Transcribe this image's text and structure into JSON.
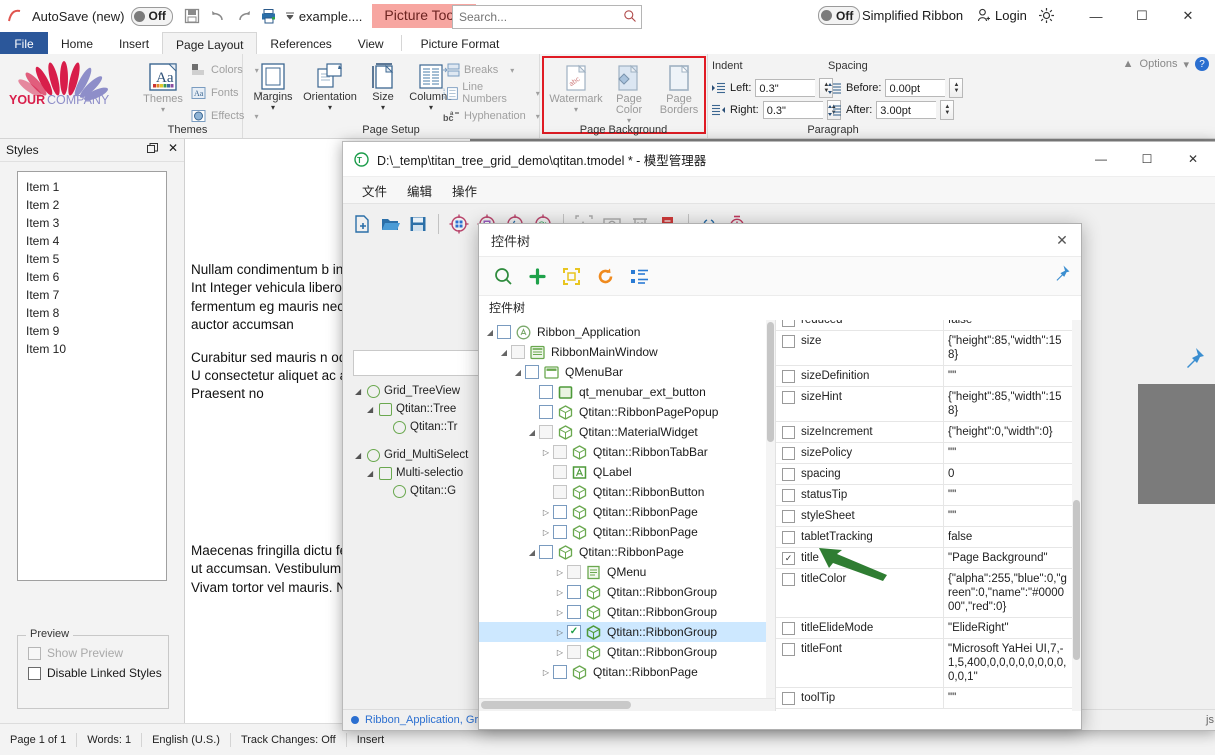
{
  "word": {
    "quick_access": {
      "autosave_label": "AutoSave (new)",
      "autosave_state": "Off",
      "save_icon": "save-icon",
      "undo_icon": "undo-icon",
      "redo_icon": "redo-icon",
      "print_icon": "print-icon",
      "dropdown_icon": "chevron-down-icon",
      "file_name": "example....",
      "contextual_tab": "Picture Tools"
    },
    "search": {
      "placeholder": "Search...",
      "value": "",
      "icon": "search-icon"
    },
    "right_controls": {
      "simplified_ribbon_state": "Off",
      "simplified_ribbon_label": "Simplified Ribbon",
      "login_label": "Login",
      "login_icon": "user-add-icon",
      "settings_icon": "gear-icon",
      "minimize": "—",
      "maximize": "☐",
      "close": "✕"
    },
    "ribbon_right": {
      "collapse_icon": "chevron-up-icon",
      "options_label": "Options",
      "options_caret": "▾",
      "help_icon": "help-icon"
    },
    "tabs": [
      {
        "label": "File",
        "state": "file"
      },
      {
        "label": "Home",
        "state": "normal"
      },
      {
        "label": "Insert",
        "state": "normal"
      },
      {
        "label": "Page Layout",
        "state": "active"
      },
      {
        "label": "References",
        "state": "normal"
      },
      {
        "label": "View",
        "state": "normal"
      },
      {
        "label": "Picture Format",
        "state": "normal"
      }
    ],
    "brand": {
      "line1": "YOUR",
      "line2": "COMPANY"
    },
    "groups": [
      {
        "name": "Themes",
        "big": [
          {
            "label": "Themes",
            "icon": "themes-icon",
            "caret": "▾"
          }
        ],
        "small": [
          {
            "label": "Colors",
            "icon": "colors-icon",
            "caret": "▾"
          },
          {
            "label": "Fonts",
            "icon": "fonts-icon",
            "caret": "▾"
          },
          {
            "label": "Effects",
            "icon": "effects-icon",
            "caret": "▾"
          }
        ]
      },
      {
        "name": "Page Setup",
        "big": [
          {
            "label": "Margins",
            "icon": "margins-icon",
            "caret": "▾"
          },
          {
            "label": "Orientation",
            "icon": "orientation-icon",
            "caret": "▾"
          },
          {
            "label": "Size",
            "icon": "size-icon",
            "caret": "▾"
          },
          {
            "label": "Columns",
            "icon": "columns-icon",
            "caret": "▾"
          }
        ],
        "small": [
          {
            "label": "Breaks",
            "icon": "breaks-icon",
            "caret": "▾"
          },
          {
            "label": "Line Numbers",
            "icon": "line-numbers-icon",
            "caret": "▾"
          },
          {
            "label": "Hyphenation",
            "icon": "hyphenation-icon",
            "caret": "▾"
          }
        ]
      },
      {
        "name": "Page Background",
        "highlight_color": "#e01b24",
        "big": [
          {
            "label": "Watermark",
            "icon": "watermark-icon",
            "caret": "▾"
          },
          {
            "label": "Page Color",
            "icon": "page-color-icon",
            "caret": "▾"
          },
          {
            "label": "Page Borders",
            "icon": "page-borders-icon",
            "caret": ""
          }
        ]
      },
      {
        "name": "Paragraph",
        "indent_label": "Indent",
        "spacing_label": "Spacing",
        "fields": [
          {
            "label": "Left:",
            "value": "0.3\"",
            "icon": "indent-left-icon"
          },
          {
            "label": "Right:",
            "value": "0.3\"",
            "icon": "indent-right-icon"
          },
          {
            "label": "Before:",
            "value": "0.00pt",
            "icon": "spacing-before-icon"
          },
          {
            "label": "After:",
            "value": "3.00pt",
            "icon": "spacing-after-icon"
          }
        ]
      }
    ],
    "styles_pane": {
      "title": "Styles",
      "restore_icon": "restore-icon",
      "close_icon": "close-icon",
      "items": [
        "Item 1",
        "Item 2",
        "Item 3",
        "Item 4",
        "Item 5",
        "Item 6",
        "Item 7",
        "Item 8",
        "Item 9",
        "Item 10"
      ],
      "preview_legend": "Preview",
      "checkboxes": [
        {
          "label": "Show Preview",
          "checked": false,
          "enabled": false
        },
        {
          "label": "Disable Linked Styles",
          "checked": false,
          "enabled": true
        }
      ]
    },
    "document": {
      "paragraphs": [
        "Nullam condimentum b interdum leo rutrum. Int Integer vehicula libero v euismod fermentum eg mauris nec consequat. diam auctor accumsan",
        "Curabitur sed mauris n odio egestas laoreet. U consectetur aliquet ac a venenatis. Praesent no",
        "Maecenas fringilla dictu feugiat at fermentum ut accumsan. Vestibulum vulputate ut odio. Vivam tortor vel mauris. Nulla"
      ]
    },
    "status_bar": {
      "page": "Page 1 of 1",
      "words": "Words: 1",
      "language": "English (U.S.)",
      "track_changes": "Track Changes: Off",
      "insert_mode": "Insert"
    }
  },
  "qt_window": {
    "app_badge": "QT",
    "title": "D:\\_temp\\titan_tree_grid_demo\\qtitan.tmodel * - 模型管理器",
    "window_buttons": {
      "minimize": "—",
      "maximize": "☐",
      "close": "✕"
    },
    "menus": [
      "文件",
      "编辑",
      "操作"
    ],
    "toolbar_icons": [
      "new-file-icon",
      "open-folder-icon",
      "save-icon",
      "target-windows-icon",
      "target-image-icon",
      "target-java-icon",
      "target-qt-icon",
      "text-capture-icon",
      "screenshot-icon",
      "delete-icon",
      "clipboard-icon",
      "link-icon",
      "timer-icon"
    ],
    "pin_icon": "pin-icon",
    "background_tree": [
      {
        "label": "Grid_TreeView",
        "depth": 0,
        "twisty": "◢",
        "icon": "circle-icon"
      },
      {
        "label": "Qtitan::Tree",
        "depth": 1,
        "twisty": "◢",
        "icon": "square-icon"
      },
      {
        "label": "Qtitan::Tr",
        "depth": 2,
        "twisty": "",
        "icon": "cube-icon"
      },
      {
        "label": "Grid_MultiSelect",
        "depth": 0,
        "twisty": "◢",
        "icon": "circle-icon"
      },
      {
        "label": "Multi-selectio",
        "depth": 1,
        "twisty": "◢",
        "icon": "square-icon"
      },
      {
        "label": "Qtitan::G",
        "depth": 2,
        "twisty": "",
        "icon": "cube-icon"
      }
    ],
    "status": {
      "text": "Ribbon_Application, Grid_Multi...",
      "right_label": "js"
    }
  },
  "control_tree_dialog": {
    "title": "控件树",
    "close_icon": "close-icon",
    "toolbar": [
      {
        "name": "search-icon",
        "glyph": "⌕",
        "color": "#2e8b3d"
      },
      {
        "name": "add-icon",
        "glyph": "＋",
        "color": "#1fa14a"
      },
      {
        "name": "capture-region-icon",
        "glyph": "⬚",
        "color": "#e8c520"
      },
      {
        "name": "refresh-icon",
        "glyph": "↻",
        "color": "#ef8a1e"
      },
      {
        "name": "tree-structure-icon",
        "glyph": "☲",
        "color": "#2a7bd4"
      }
    ],
    "pin_icon": "pin-icon",
    "subtitle": "控件树",
    "tree": [
      {
        "label": "Ribbon_Application",
        "depth": 0,
        "twisty": "open",
        "checked": false,
        "enabled": true,
        "icon": "app-circle-icon"
      },
      {
        "label": "RibbonMainWindow",
        "depth": 1,
        "twisty": "open",
        "checked": false,
        "enabled": false,
        "icon": "window-icon"
      },
      {
        "label": "QMenuBar",
        "depth": 2,
        "twisty": "open",
        "checked": false,
        "enabled": true,
        "icon": "menubar-icon"
      },
      {
        "label": "qt_menubar_ext_button",
        "depth": 3,
        "twisty": "none",
        "checked": false,
        "enabled": true,
        "icon": "button-icon"
      },
      {
        "label": "Qtitan::RibbonPagePopup",
        "depth": 3,
        "twisty": "none",
        "checked": false,
        "enabled": true,
        "icon": "cube-icon"
      },
      {
        "label": "Qtitan::MaterialWidget",
        "depth": 3,
        "twisty": "open",
        "checked": false,
        "enabled": false,
        "icon": "cube-icon"
      },
      {
        "label": "Qtitan::RibbonTabBar",
        "depth": 4,
        "twisty": "closed",
        "checked": false,
        "enabled": false,
        "icon": "cube-icon"
      },
      {
        "label": "QLabel",
        "depth": 4,
        "twisty": "none",
        "checked": false,
        "enabled": false,
        "icon": "label-icon"
      },
      {
        "label": "Qtitan::RibbonButton",
        "depth": 4,
        "twisty": "none",
        "checked": false,
        "enabled": false,
        "icon": "cube-icon"
      },
      {
        "label": "Qtitan::RibbonPage",
        "depth": 4,
        "twisty": "closed",
        "checked": false,
        "enabled": true,
        "icon": "cube-icon"
      },
      {
        "label": "Qtitan::RibbonPage",
        "depth": 4,
        "twisty": "closed",
        "checked": false,
        "enabled": true,
        "icon": "cube-icon"
      },
      {
        "label": "Qtitan::RibbonPage",
        "depth": 4,
        "twisty": "open",
        "checked": false,
        "enabled": true,
        "icon": "cube-icon"
      },
      {
        "label": "QMenu",
        "depth": 5,
        "twisty": "closed",
        "checked": false,
        "enabled": false,
        "icon": "menu-icon"
      },
      {
        "label": "Qtitan::RibbonGroup",
        "depth": 5,
        "twisty": "closed",
        "checked": false,
        "enabled": true,
        "icon": "cube-icon"
      },
      {
        "label": "Qtitan::RibbonGroup",
        "depth": 5,
        "twisty": "closed",
        "checked": false,
        "enabled": true,
        "icon": "cube-icon"
      },
      {
        "label": "Qtitan::RibbonGroup",
        "depth": 5,
        "twisty": "closed",
        "checked": true,
        "enabled": true,
        "selected": true,
        "icon": "cube-icon"
      },
      {
        "label": "Qtitan::RibbonGroup",
        "depth": 5,
        "twisty": "closed",
        "checked": false,
        "enabled": false,
        "icon": "cube-icon"
      },
      {
        "label": "Qtitan::RibbonPage",
        "depth": 4,
        "twisty": "closed",
        "checked": false,
        "enabled": true,
        "icon": "cube-icon"
      }
    ],
    "properties": [
      {
        "name": "reduced",
        "value": "false",
        "checked": false,
        "clipped": true
      },
      {
        "name": "size",
        "value": "{\"height\":85,\"width\":158}",
        "checked": false
      },
      {
        "name": "sizeDefinition",
        "value": "\"\"",
        "checked": false
      },
      {
        "name": "sizeHint",
        "value": "{\"height\":85,\"width\":158}",
        "checked": false
      },
      {
        "name": "sizeIncrement",
        "value": "{\"height\":0,\"width\":0}",
        "checked": false
      },
      {
        "name": "sizePolicy",
        "value": "\"\"",
        "checked": false
      },
      {
        "name": "spacing",
        "value": "0",
        "checked": false
      },
      {
        "name": "statusTip",
        "value": "\"\"",
        "checked": false
      },
      {
        "name": "styleSheet",
        "value": "\"\"",
        "checked": false
      },
      {
        "name": "tabletTracking",
        "value": "false",
        "checked": false
      },
      {
        "name": "title",
        "value": "\"Page Background\"",
        "checked": true
      },
      {
        "name": "titleColor",
        "value": "{\"alpha\":255,\"blue\":0,\"green\":0,\"name\":\"#000000\",\"red\":0}",
        "checked": false
      },
      {
        "name": "titleElideMode",
        "value": "\"ElideRight\"",
        "checked": false
      },
      {
        "name": "titleFont",
        "value": "\"Microsoft YaHei UI,7,-1,5,400,0,0,0,0,0,0,0,0,0,0,1\"",
        "checked": false
      },
      {
        "name": "toolTip",
        "value": "\"\"",
        "checked": false
      }
    ],
    "annotation": {
      "name": "green-arrow-annotation",
      "color": "#2f7d32"
    }
  }
}
